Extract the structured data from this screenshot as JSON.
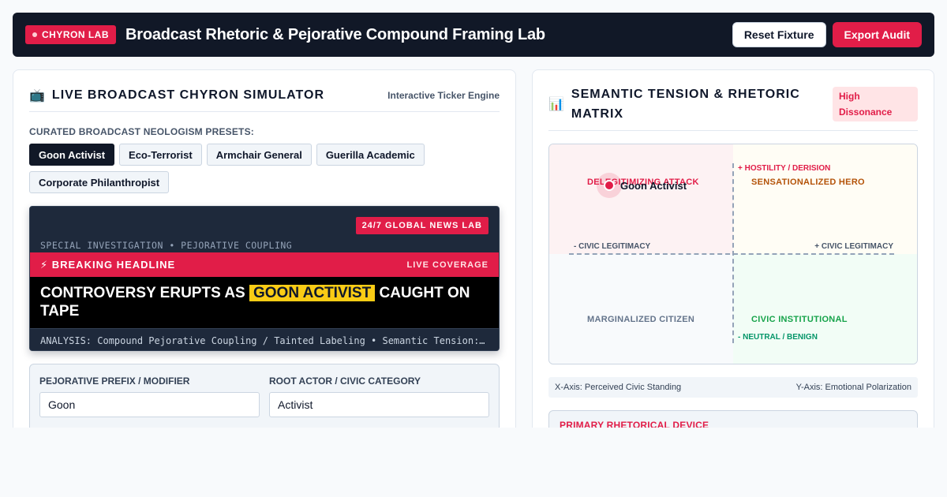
{
  "header": {
    "badge": "CHYRON LAB",
    "title": "Broadcast Rhetoric & Pejorative Compound Framing Lab",
    "reset_label": "Reset Fixture",
    "export_label": "Export Audit"
  },
  "simulator": {
    "icon": "tv-icon",
    "title": "LIVE BROADCAST CHYRON SIMULATOR",
    "tag": "Interactive Ticker Engine",
    "presets_label": "CURATED BROADCAST NEOLOGISM PRESETS:",
    "presets": [
      "Goon Activist",
      "Eco-Terrorist",
      "Armchair General",
      "Guerilla Academic",
      "Corporate Philanthropist"
    ],
    "active_preset": "Goon Activist"
  },
  "chyron": {
    "network": "24/7 GLOBAL NEWS LAB",
    "kicker": "SPECIAL INVESTIGATION • PEJORATIVE COUPLING",
    "alert": "⚡ BREAKING HEADLINE",
    "alert_right": "LIVE COVERAGE",
    "headline_before": "CONTROVERSY ERUPTS AS",
    "headline_highlight": "GOON ACTIVIST",
    "headline_after": "CAUGHT ON TAPE",
    "ticker": "ANALYSIS: Compound Pejorative Coupling / Tainted Labeling • Semantic Tension: High Dissonance"
  },
  "form": {
    "prefix_label": "PEJORATIVE PREFIX / MODIFIER",
    "prefix_value": "Goon",
    "root_label": "ROOT ACTOR / CIVIC CATEGORY",
    "root_value": "Activist"
  },
  "matrix": {
    "icon": "bar-chart-icon",
    "title": "SEMANTIC TENSION & RHETORIC MATRIX",
    "badge": "High Dissonance",
    "y_pos": "+ HOSTILITY / DERISION",
    "y_neg": "- NEUTRAL / BENIGN",
    "x_neg": "- CIVIC LEGITIMACY",
    "x_pos": "+ CIVIC LEGITIMACY",
    "quadrants": {
      "top_left": "DELEGITIMIZING ATTACK",
      "top_right": "SENSATIONALIZED HERO",
      "bottom_left": "MARGINALIZED CITIZEN",
      "bottom_right": "CIVIC INSTITUTIONAL"
    },
    "point_label": "Goon Activist",
    "x_axis_legend": "X-Axis: Perceived Civic Standing",
    "y_axis_legend": "Y-Axis: Emotional Polarization",
    "device_label": "PRIMARY RHETORICAL DEVICE"
  },
  "colors": {
    "accent": "#e11d48",
    "header_bg": "#111827",
    "highlight": "#facc15",
    "attack": "#e11d48",
    "hero": "#b45309",
    "marginal": "#64748b",
    "civic": "#16a34a"
  }
}
